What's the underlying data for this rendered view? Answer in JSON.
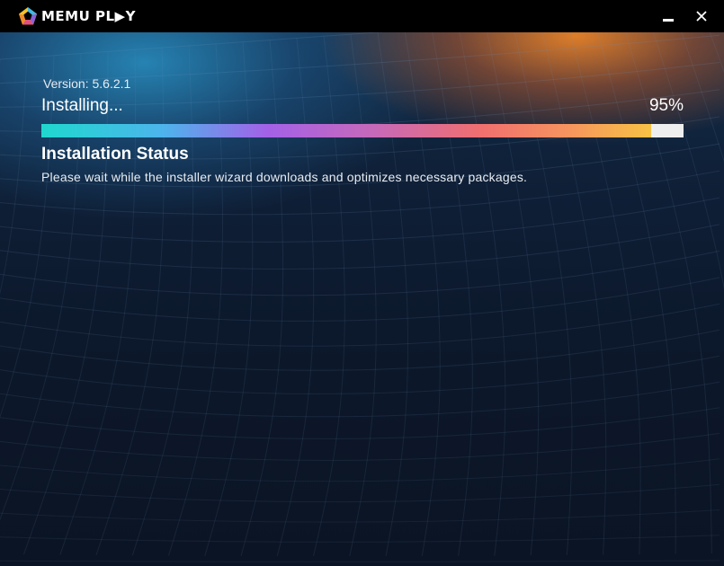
{
  "titlebar": {
    "brand_text": "MEMU PL▶Y",
    "logo_icon": "memu-pentagon-logo-icon",
    "minimize_icon": "minimize-icon",
    "close_icon": "close-icon",
    "close_glyph": "✕"
  },
  "installer": {
    "version": "Version: 5.6.2.1",
    "status": "Installing...",
    "percent_text": "95%",
    "progress_fraction": 0.95,
    "section_title": "Installation Status",
    "section_desc": "Please wait while the installer wizard downloads and optimizes necessary packages."
  },
  "colors": {
    "titlebar_bg": "#000000",
    "progress_track": "#eeeeee",
    "progress_start": "#1fd8cf",
    "progress_end": "#f7c245",
    "accent_orange": "#e88228",
    "accent_blue": "#288cbe"
  }
}
